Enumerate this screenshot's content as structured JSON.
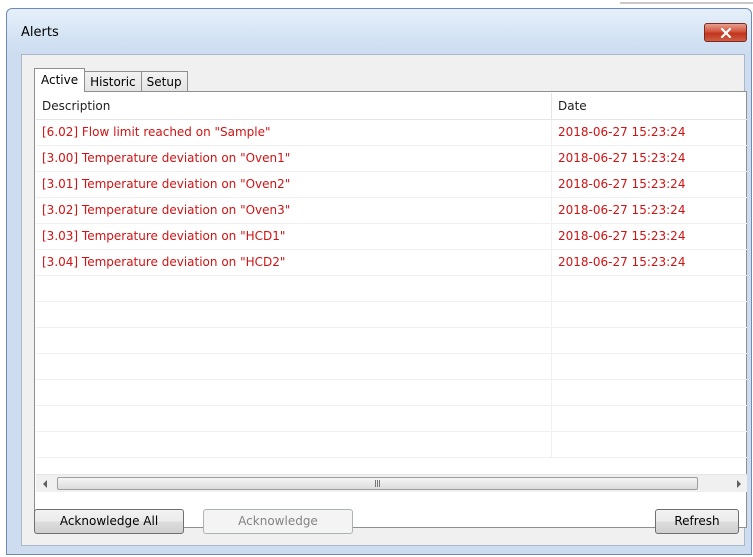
{
  "window": {
    "title": "Alerts"
  },
  "tabs": [
    {
      "label": "Active",
      "selected": true
    },
    {
      "label": "Historic",
      "selected": false
    },
    {
      "label": "Setup",
      "selected": false
    }
  ],
  "table": {
    "columns": [
      "Description",
      "Date"
    ],
    "rows": [
      {
        "description": "[6.02] Flow limit reached on \"Sample\"",
        "date": "2018-06-27 15:23:24"
      },
      {
        "description": "[3.00] Temperature deviation on \"Oven1\"",
        "date": "2018-06-27 15:23:24"
      },
      {
        "description": "[3.01] Temperature deviation on \"Oven2\"",
        "date": "2018-06-27 15:23:24"
      },
      {
        "description": "[3.02] Temperature deviation on \"Oven3\"",
        "date": "2018-06-27 15:23:24"
      },
      {
        "description": "[3.03] Temperature deviation on \"HCD1\"",
        "date": "2018-06-27 15:23:24"
      },
      {
        "description": "[3.04] Temperature deviation on \"HCD2\"",
        "date": "2018-06-27 15:23:24"
      }
    ],
    "alert_color": "#d11313"
  },
  "buttons": {
    "acknowledge_all": "Acknowledge All",
    "acknowledge": "Acknowledge",
    "refresh": "Refresh"
  },
  "icons": {
    "close": "close-icon",
    "scroll_left": "arrow-left-icon",
    "scroll_right": "arrow-right-icon",
    "thumb_grip": "grip-icon"
  }
}
